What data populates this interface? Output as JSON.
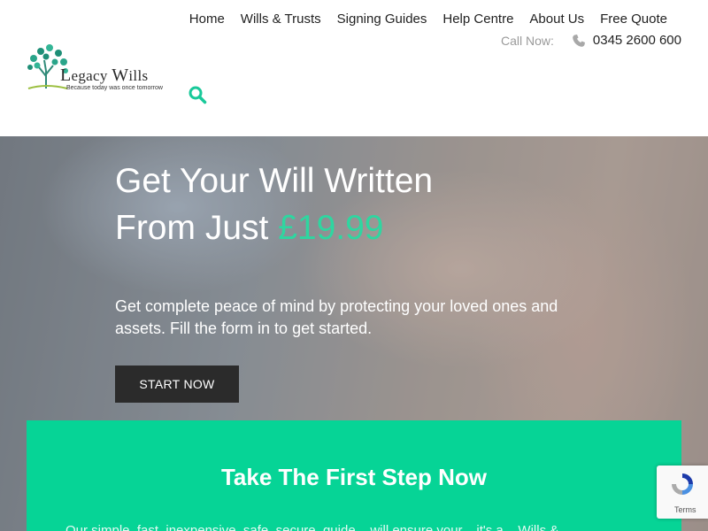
{
  "header": {
    "logo": {
      "name_first": "L",
      "name_rest": "egacy ",
      "name_first2": "W",
      "name_rest2": "ills",
      "tagline": "Because today was once tomorrow"
    },
    "nav": [
      "Home",
      "Wills & Trusts",
      "Signing Guides",
      "Help Centre",
      "About Us",
      "Free Quote"
    ],
    "call_label": "Call Now:",
    "phone": "0345 2600 600",
    "search_icon": "search-icon",
    "phone_icon": "phone-icon"
  },
  "hero": {
    "title_line1": "Get Your Will Written",
    "title_line2": "From Just ",
    "price": "£19.99",
    "subtitle": "Get complete peace of mind by protecting your loved ones and assets. Fill the form in to get started.",
    "cta": "START NOW"
  },
  "step": {
    "title": "Take The First Step Now",
    "text": "Our simple, fast, inexpensive, safe, secure, guide... will ensure your... it's a... Wills &"
  },
  "recaptcha": {
    "terms": "Terms"
  },
  "colors": {
    "accent": "#06d496",
    "price": "#2fd6a0",
    "button": "#2b2b2b",
    "logo_green": "#2a9d8f"
  }
}
